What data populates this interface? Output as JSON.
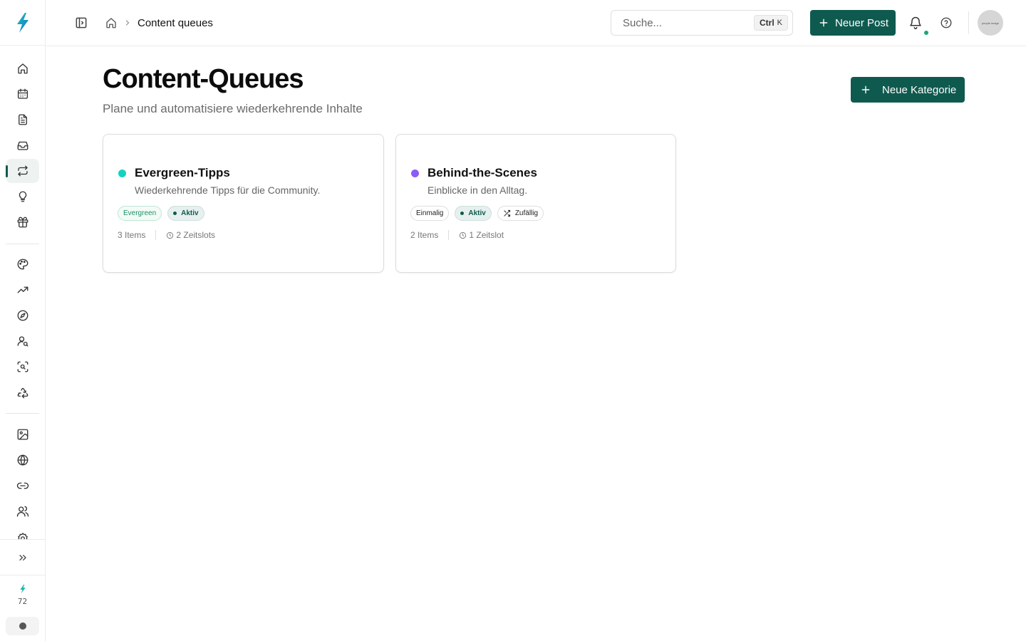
{
  "colors": {
    "accent": "#0f5a4f",
    "brand": "#14b8a6",
    "evergreen_dot": "#14d2c0",
    "bts_dot": "#8b5cf6",
    "notification": "#1aa874"
  },
  "sidebar": {
    "items": [
      {
        "name": "home-icon",
        "icon": "home"
      },
      {
        "name": "calendar-icon",
        "icon": "calendar"
      },
      {
        "name": "document-icon",
        "icon": "document"
      },
      {
        "name": "inbox-icon",
        "icon": "inbox"
      },
      {
        "name": "repeat-icon",
        "icon": "repeat",
        "active": true
      },
      {
        "name": "lightbulb-icon",
        "icon": "lightbulb"
      },
      {
        "name": "gift-icon",
        "icon": "gift"
      },
      {
        "name": "palette-icon",
        "icon": "palette"
      },
      {
        "name": "trending-icon",
        "icon": "trending"
      },
      {
        "name": "compass-icon",
        "icon": "compass"
      },
      {
        "name": "user-search-icon",
        "icon": "user-search"
      },
      {
        "name": "scan-search-icon",
        "icon": "scan-search"
      },
      {
        "name": "recycle-icon",
        "icon": "recycle"
      },
      {
        "name": "image-icon",
        "icon": "image"
      },
      {
        "name": "globe-icon",
        "icon": "globe"
      },
      {
        "name": "link-icon",
        "icon": "link"
      },
      {
        "name": "users-icon",
        "icon": "users"
      },
      {
        "name": "settings-icon",
        "icon": "settings"
      }
    ],
    "credits": "72"
  },
  "topbar": {
    "breadcrumb_current": "Content queues",
    "search_placeholder": "Suche...",
    "shortcut_mod": "Ctrl",
    "shortcut_key": "K",
    "new_post_label": "Neuer Post",
    "avatar_text": "people image"
  },
  "main": {
    "title": "Content-Queues",
    "subtitle": "Plane und automatisiere wiederkehrende Inhalte",
    "new_category_label": "Neue Kategorie",
    "cards": [
      {
        "title": "Evergreen-Tipps",
        "description": "Wiederkehrende Tipps für die Community.",
        "badges": [
          "Evergreen",
          "Aktiv"
        ],
        "items": "3 Items",
        "slots": "2 Zeitslots"
      },
      {
        "title": "Behind-the-Scenes",
        "description": "Einblicke in den Alltag.",
        "badges": [
          "Einmalig",
          "Aktiv",
          "Zufällig"
        ],
        "items": "2 Items",
        "slots": "1 Zeitslot"
      }
    ]
  }
}
